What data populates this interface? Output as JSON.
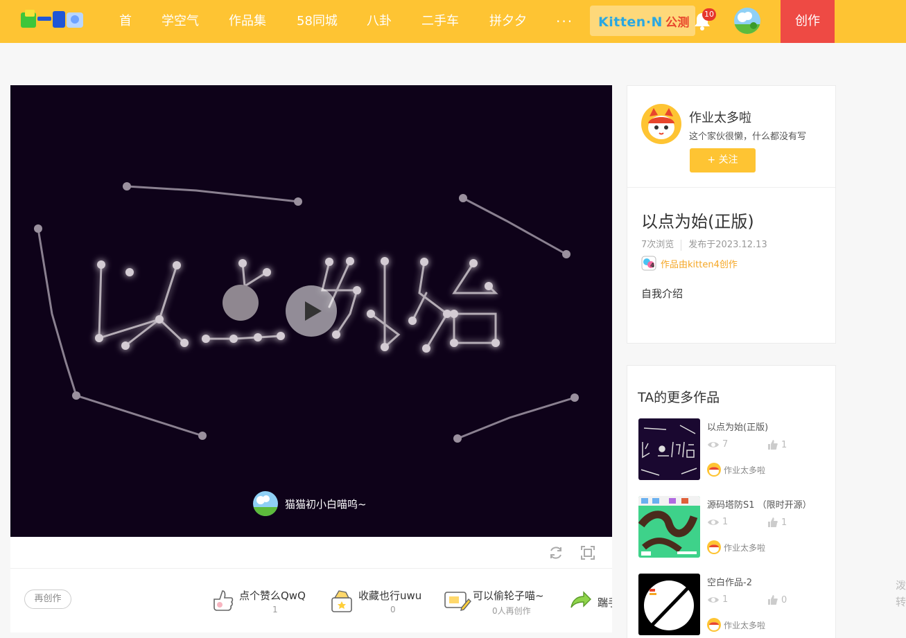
{
  "nav": {
    "items": [
      "首",
      "学空气",
      "作品集",
      "58同城",
      "八卦",
      "二手车",
      "拼夕夕",
      "···"
    ],
    "kitten_label": "Kitten·N",
    "kitten_suffix": "公测",
    "notification_count": "10",
    "create_label": "创作"
  },
  "player": {
    "author_name": "猫猫初小白喵呜~"
  },
  "actions": {
    "remake_label": "再创作",
    "like_label": "点个赞么QwQ",
    "like_count": "1",
    "collect_label": "收藏也行uwu",
    "collect_count": "0",
    "fork_label": "可以偷轮子喵~",
    "fork_count": "0人再创作",
    "share_label": "踹手手"
  },
  "profile": {
    "name": "作业太多啦",
    "bio": "这个家伙很懒，什么都没有写",
    "follow_label": "+ 关注"
  },
  "work": {
    "title": "以点为始(正版)",
    "views": "7次浏览",
    "published": "发布于2023.12.13",
    "tool": "作品由kitten4创作",
    "intro_label": "自我介绍"
  },
  "more": {
    "title": "TA的更多作品",
    "items": [
      {
        "name": "以点为始(正版)",
        "views": "7",
        "likes": "1",
        "author": "作业太多啦"
      },
      {
        "name": "源码塔防S1 （限时开源）",
        "views": "1",
        "likes": "1",
        "author": "作业太多啦"
      },
      {
        "name": "空白作品-2",
        "views": "1",
        "likes": "0",
        "author": "作业太多啦"
      }
    ]
  },
  "side_cut_text": "泼转",
  "colors": {
    "brand_yellow": "#fec433",
    "create_red": "#ee4a44",
    "player_bg": "#0e0219",
    "tool_orange": "#f5a623"
  }
}
